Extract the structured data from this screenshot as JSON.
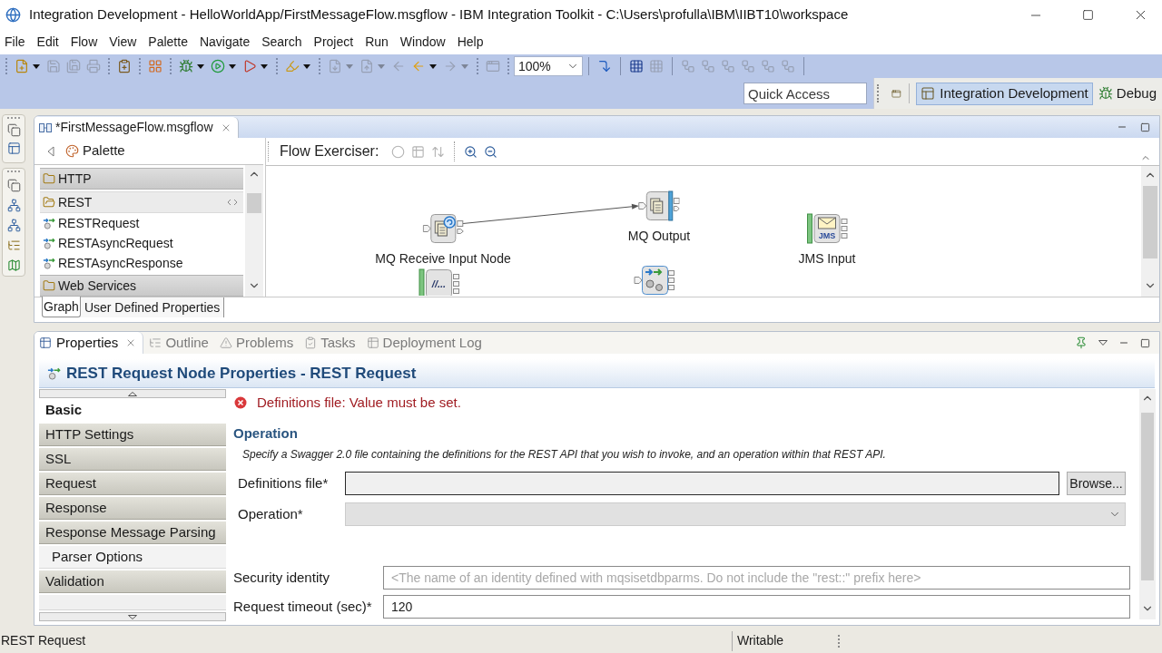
{
  "window": {
    "title": "Integration Development - HelloWorldApp/FirstMessageFlow.msgflow - IBM Integration Toolkit - C:\\Users\\profulla\\IBM\\IIBT10\\workspace"
  },
  "menu": [
    "File",
    "Edit",
    "Flow",
    "View",
    "Palette",
    "Navigate",
    "Search",
    "Project",
    "Run",
    "Window",
    "Help"
  ],
  "toolbar": {
    "groups": [
      [
        {
          "disabled": false,
          "dropdown": true
        },
        {
          "disabled": true
        },
        {
          "disabled": true
        },
        {
          "disabled": true
        }
      ],
      [
        {
          "disabled": false
        }
      ],
      [
        {
          "disabled": false
        }
      ],
      [
        {
          "disabled": false,
          "dropdown": true
        },
        {
          "disabled": false,
          "dropdown": true
        },
        {
          "disabled": false,
          "dropdown": true
        }
      ],
      [
        {
          "disabled": false,
          "dropdown": true
        }
      ],
      [
        {
          "disabled": true,
          "dropdown": true
        },
        {
          "disabled": true,
          "dropdown": true
        },
        {
          "disabled": true
        },
        {
          "disabled": false,
          "dropdown": true
        },
        {
          "disabled": true,
          "dropdown": true
        }
      ],
      [
        {
          "disabled": true
        }
      ]
    ],
    "zoom": "100%",
    "groups_after_zoom": [
      [
        {
          "disabled": false
        }
      ],
      [
        {
          "disabled": false
        },
        {
          "disabled": true
        }
      ],
      [
        {
          "disabled": true
        },
        {
          "disabled": true
        },
        {
          "disabled": true
        },
        {
          "disabled": true
        },
        {
          "disabled": true
        },
        {
          "disabled": true
        }
      ]
    ]
  },
  "quick_access": {
    "placeholder": "Quick Access"
  },
  "perspectives": [
    {
      "label": "Integration Development",
      "selected": true
    },
    {
      "label": "Debug",
      "selected": false
    }
  ],
  "editor": {
    "tab": "*FirstMessageFlow.msgflow",
    "palette": {
      "title": "Palette",
      "drawers": [
        {
          "label": "HTTP",
          "expanded": false
        },
        {
          "label": "REST",
          "expanded": true,
          "items": [
            "RESTRequest",
            "RESTAsyncRequest",
            "RESTAsyncResponse"
          ]
        },
        {
          "label": "Web Services",
          "expanded": false
        }
      ]
    },
    "exerciser": {
      "label": "Flow Exerciser:",
      "groups": [
        [
          {
            "disabled": true
          },
          {
            "disabled": true
          },
          {
            "disabled": true
          }
        ],
        [
          {
            "disabled": false
          },
          {
            "disabled": false
          }
        ]
      ]
    },
    "nodes": [
      {
        "kind": "mq_receive",
        "label": "MQ Receive Input Node"
      },
      {
        "kind": "mq_output",
        "label": "MQ Output"
      },
      {
        "kind": "jms_input",
        "label": "JMS Input",
        "badge": "JMS"
      },
      {
        "kind": "file_read",
        "badge": "//..."
      },
      {
        "kind": "mapping"
      }
    ],
    "bottom_tabs": [
      {
        "label": "Graph",
        "selected": true
      },
      {
        "label": "User Defined Properties",
        "selected": false
      }
    ]
  },
  "views": [
    {
      "label": "Properties",
      "selected": true
    },
    {
      "label": "Outline",
      "selected": false
    },
    {
      "label": "Problems",
      "selected": false
    },
    {
      "label": "Tasks",
      "selected": false
    },
    {
      "label": "Deployment Log",
      "selected": false
    }
  ],
  "properties": {
    "title": "REST Request Node Properties - REST Request",
    "tabs": [
      {
        "label": "Basic",
        "selected": true
      },
      {
        "label": "HTTP Settings",
        "selected": false
      },
      {
        "label": "SSL",
        "selected": false
      },
      {
        "label": "Request",
        "selected": false
      },
      {
        "label": "Response",
        "selected": false
      },
      {
        "label": "Response Message Parsing",
        "selected": false,
        "children": [
          {
            "label": "Parser Options",
            "selected": false
          }
        ]
      },
      {
        "label": "Validation",
        "selected": false
      }
    ],
    "error": "Definitions file: Value must be set.",
    "section": {
      "title": "Operation",
      "description": "Specify a Swagger 2.0 file containing the definitions for the REST API that you wish to invoke, and an operation within that REST API.",
      "fields": [
        {
          "kind": "file",
          "label": "Definitions file*",
          "button": "Browse..."
        },
        {
          "kind": "select",
          "label": "Operation*",
          "disabled": true
        }
      ]
    },
    "fields": [
      {
        "kind": "text",
        "label": "Security identity",
        "placeholder": "<The name of an identity defined with mqsisetdbparms. Do not include the \"rest::\" prefix here>"
      },
      {
        "kind": "text",
        "label": "Request timeout (sec)*",
        "value": "120"
      }
    ]
  },
  "status_bar": {
    "message": "REST Request",
    "mode": "Writable"
  }
}
